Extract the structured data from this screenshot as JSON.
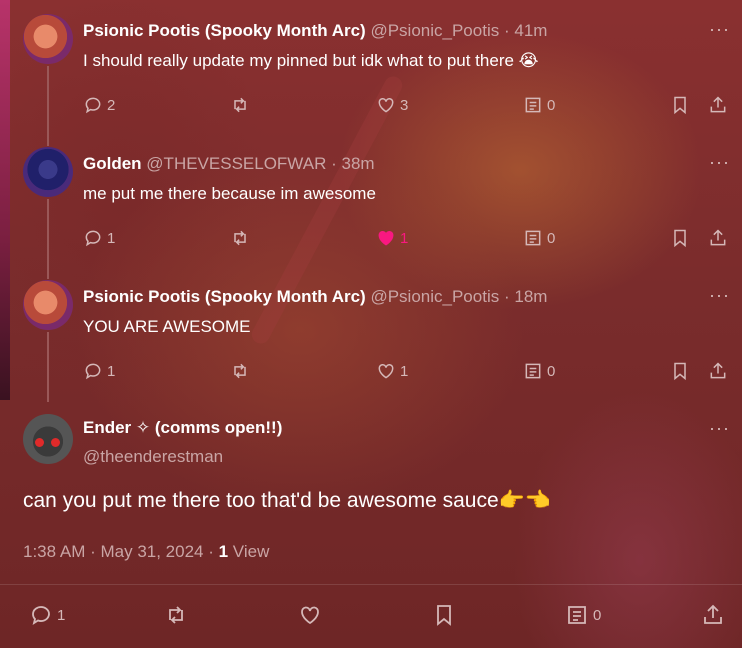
{
  "replies": [
    {
      "name": "Psionic Pootis (Spooky Month Arc)",
      "handle": "@Psionic_Pootis",
      "time": "41m",
      "text": "I should really update my pinned but idk what to put there 😭",
      "replies": "2",
      "reposts": "",
      "likes": "3",
      "views": "0",
      "liked": false
    },
    {
      "name": "Golden",
      "handle": "@THEVESSELOFWAR",
      "time": "38m",
      "text": "me put me there because im awesome",
      "replies": "1",
      "reposts": "",
      "likes": "1",
      "views": "0",
      "liked": true
    },
    {
      "name": "Psionic Pootis (Spooky Month Arc)",
      "handle": "@Psionic_Pootis",
      "time": "18m",
      "text": "YOU ARE AWESOME",
      "replies": "1",
      "reposts": "",
      "likes": "1",
      "views": "0",
      "liked": false
    }
  ],
  "main_post": {
    "name": "Ender ✧ (comms open!!)",
    "handle": "@theenderestman",
    "text": "can you put me there too that'd be awesome sauce👉👈",
    "timestamp": "1:38 AM · May 31, 2024 · ",
    "views_count": "1",
    "views_label": " View",
    "replies": "1",
    "reposts": "",
    "likes": "",
    "views": "0"
  },
  "dot": "·",
  "more": "···",
  "colors": {
    "like": "#f91880",
    "muted": "#c9a5a5"
  },
  "icons": [
    "reply-icon",
    "repost-icon",
    "like-icon",
    "views-icon",
    "bookmark-icon",
    "share-icon",
    "more-icon"
  ]
}
